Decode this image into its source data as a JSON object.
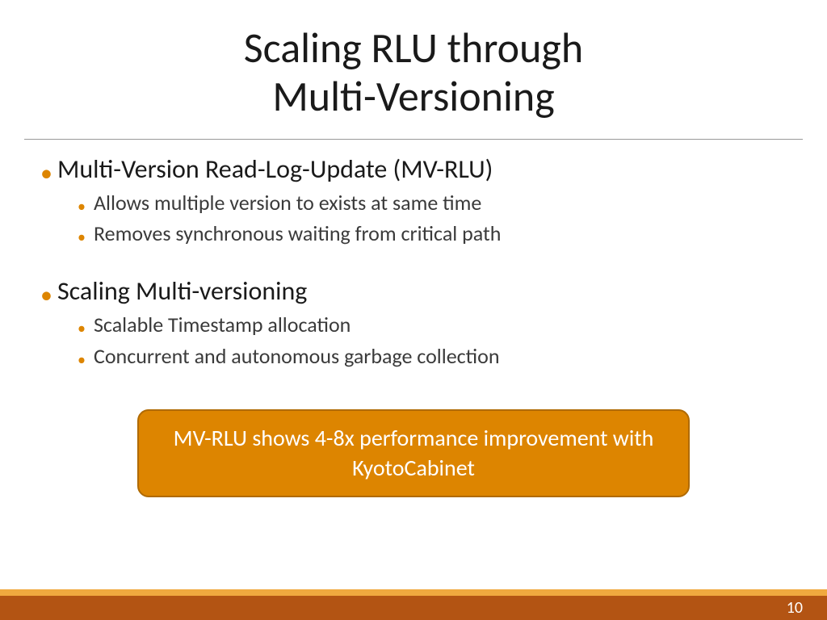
{
  "title": {
    "line1": "Scaling RLU through",
    "line2": "Multi-Versioning"
  },
  "bullets": {
    "b1": "Multi-Version Read-Log-Update (MV-RLU)",
    "b1_sub1": "Allows multiple version to exists at same time",
    "b1_sub2": "Removes synchronous waiting from critical path",
    "b2": "Scaling Multi-versioning",
    "b2_sub1": "Scalable Timestamp allocation",
    "b2_sub2": "Concurrent and autonomous garbage collection"
  },
  "callout": {
    "text": "MV-RLU shows 4-8x performance improvement with KyotoCabinet"
  },
  "footer": {
    "page_number": "10"
  },
  "colors": {
    "accent": "#dd8500",
    "footer_top": "#f0a93f",
    "footer_bottom": "#b35413"
  }
}
